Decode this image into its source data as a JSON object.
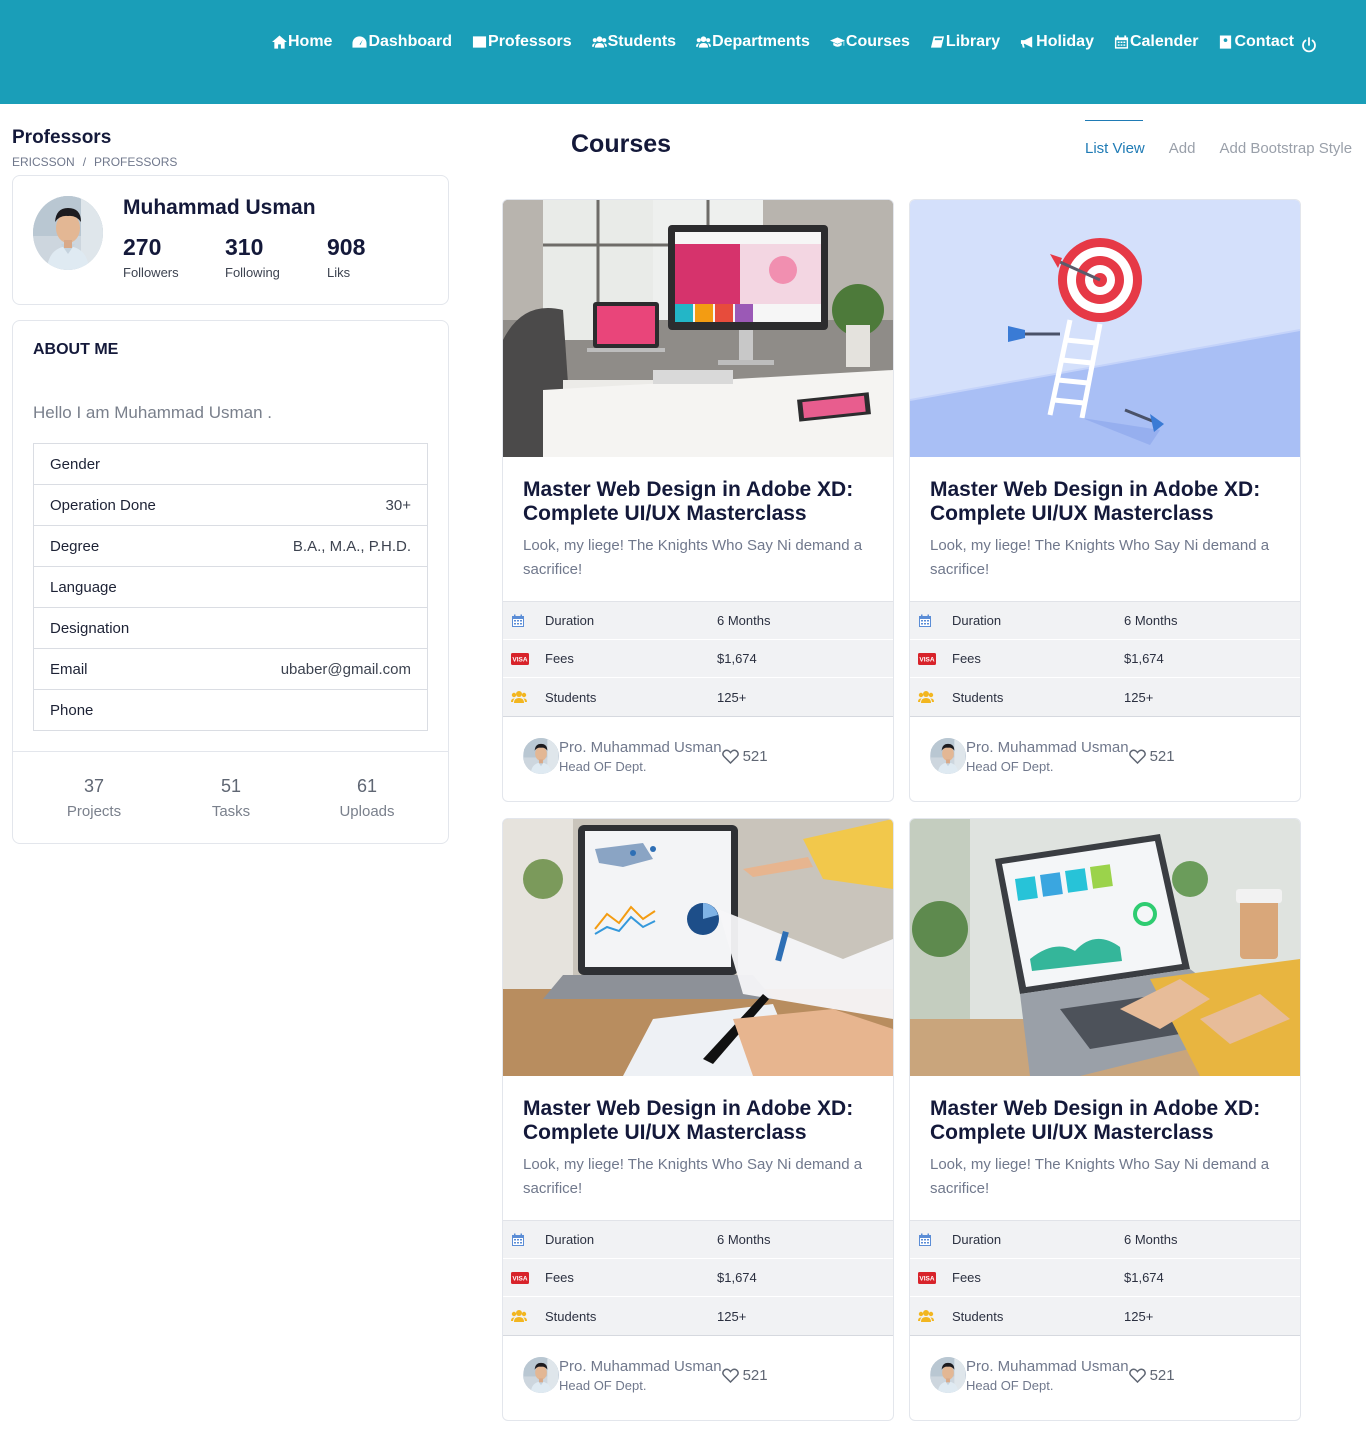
{
  "nav": {
    "items": [
      {
        "label": "Home",
        "icon": "home-icon"
      },
      {
        "label": "Dashboard",
        "icon": "gauge-icon"
      },
      {
        "label": "Professors",
        "icon": "id-card-icon"
      },
      {
        "label": "Students",
        "icon": "users-icon"
      },
      {
        "label": "Departments",
        "icon": "users-icon"
      },
      {
        "label": "Courses",
        "icon": "graduation-cap-icon"
      },
      {
        "label": "Library",
        "icon": "book-icon"
      },
      {
        "label": "Holiday",
        "icon": "megaphone-icon"
      },
      {
        "label": "Calender",
        "icon": "calendar-icon"
      },
      {
        "label": "Contact",
        "icon": "contact-card-icon"
      }
    ],
    "power_icon": "power-icon",
    "bar_color": "#1a9eb8"
  },
  "page": {
    "title": "Professors",
    "breadcrumb": [
      "ERICSSON",
      "PROFESSORS"
    ]
  },
  "profile": {
    "name": "Muhammad Usman",
    "stats": [
      {
        "value": "270",
        "label": "Followers"
      },
      {
        "value": "310",
        "label": "Following"
      },
      {
        "value": "908",
        "label": "Liks"
      }
    ]
  },
  "about": {
    "title": "ABOUT ME",
    "text": "Hello I am Muhammad Usman .",
    "rows": [
      {
        "key": "Gender",
        "value": ""
      },
      {
        "key": "Operation Done",
        "value": "30+"
      },
      {
        "key": "Degree",
        "value": "B.A., M.A., P.H.D."
      },
      {
        "key": "Language",
        "value": ""
      },
      {
        "key": "Designation",
        "value": ""
      },
      {
        "key": "Email",
        "value": "ubaber@gmail.com"
      },
      {
        "key": "Phone",
        "value": ""
      }
    ],
    "bottom_stats": [
      {
        "value": "37",
        "label": "Projects"
      },
      {
        "value": "51",
        "label": "Tasks"
      },
      {
        "value": "61",
        "label": "Uploads"
      }
    ]
  },
  "courses": {
    "title": "Courses",
    "tabs": [
      "List View",
      "Add",
      "Add Bootstrap Style"
    ],
    "active_tab": "List View",
    "cards": [
      {
        "title": "Master Web Design in Adobe XD: Complete UI/UX Masterclass",
        "description": "Look, my liege! The Knights Who Say Ni demand a sacrifice!",
        "rows": [
          {
            "icon": "calendar-icon",
            "key": "Duration",
            "value": "6 Months"
          },
          {
            "icon": "visa-icon",
            "key": "Fees",
            "value": "$1,674"
          },
          {
            "icon": "users-icon",
            "key": "Students",
            "value": "125+"
          }
        ],
        "instructor": "Pro. Muhammad Usman",
        "role": "Head OF Dept.",
        "likes": "521",
        "image": "desk-computer-photo"
      },
      {
        "title": "Master Web Design in Adobe XD: Complete UI/UX Masterclass",
        "description": "Look, my liege! The Knights Who Say Ni demand a sacrifice!",
        "rows": [
          {
            "icon": "calendar-icon",
            "key": "Duration",
            "value": "6 Months"
          },
          {
            "icon": "visa-icon",
            "key": "Fees",
            "value": "$1,674"
          },
          {
            "icon": "users-icon",
            "key": "Students",
            "value": "125+"
          }
        ],
        "instructor": "Pro. Muhammad Usman",
        "role": "Head OF Dept.",
        "likes": "521",
        "image": "target-ladder-illustration"
      },
      {
        "title": "Master Web Design in Adobe XD: Complete UI/UX Masterclass",
        "description": "Look, my liege! The Knights Who Say Ni demand a sacrifice!",
        "rows": [
          {
            "icon": "calendar-icon",
            "key": "Duration",
            "value": "6 Months"
          },
          {
            "icon": "visa-icon",
            "key": "Fees",
            "value": "$1,674"
          },
          {
            "icon": "users-icon",
            "key": "Students",
            "value": "125+"
          }
        ],
        "instructor": "Pro. Muhammad Usman",
        "role": "Head OF Dept.",
        "likes": "521",
        "image": "analytics-laptop-photo"
      },
      {
        "title": "Master Web Design in Adobe XD: Complete UI/UX Masterclass",
        "description": "Look, my liege! The Knights Who Say Ni demand a sacrifice!",
        "rows": [
          {
            "icon": "calendar-icon",
            "key": "Duration",
            "value": "6 Months"
          },
          {
            "icon": "visa-icon",
            "key": "Fees",
            "value": "$1,674"
          },
          {
            "icon": "users-icon",
            "key": "Students",
            "value": "125+"
          }
        ],
        "instructor": "Pro. Muhammad Usman",
        "role": "Head OF Dept.",
        "likes": "521",
        "image": "dashboard-laptop-photo"
      }
    ]
  }
}
